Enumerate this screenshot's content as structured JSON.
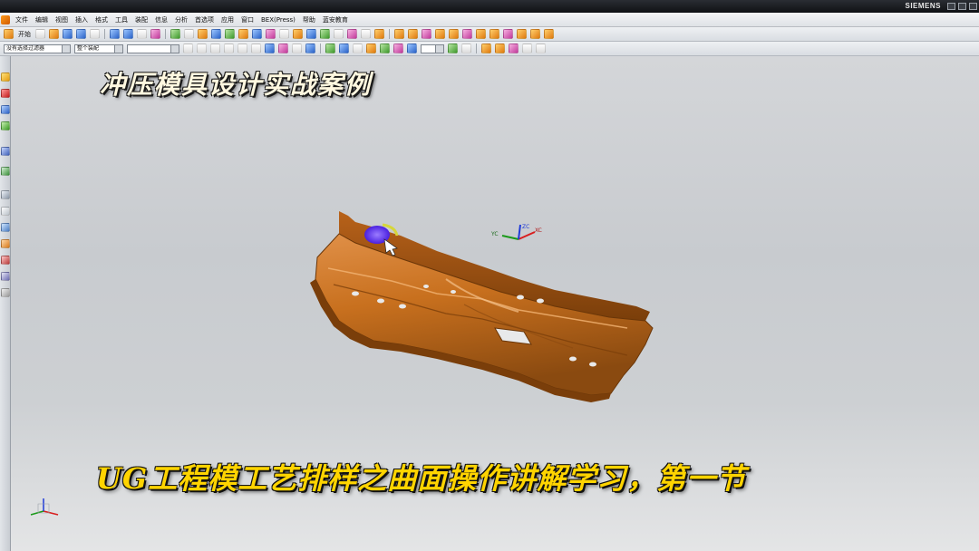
{
  "window": {
    "brand": "SIEMENS"
  },
  "menu": {
    "items": [
      "文件",
      "编辑",
      "视图",
      "插入",
      "格式",
      "工具",
      "装配",
      "信息",
      "分析",
      "首选项",
      "应用",
      "窗口",
      "BEX(Press)",
      "帮助",
      "蓝安教育"
    ]
  },
  "toolbar": {
    "start_label": "开始",
    "selection_filter": "没有选择过滤器",
    "assembly_scope": "整个装配"
  },
  "captions": {
    "top": "冲压模具设计实战案例",
    "bottom": "UG工程模工艺排样之曲面操作讲解学习，第一节"
  },
  "axes": {
    "x": "XC",
    "y": "YC",
    "z": "ZC"
  },
  "colors": {
    "part": "#c8701e",
    "highlight": "#6a3cff",
    "caption_bottom": "#ffd400",
    "caption_top": "#fff8e0"
  }
}
